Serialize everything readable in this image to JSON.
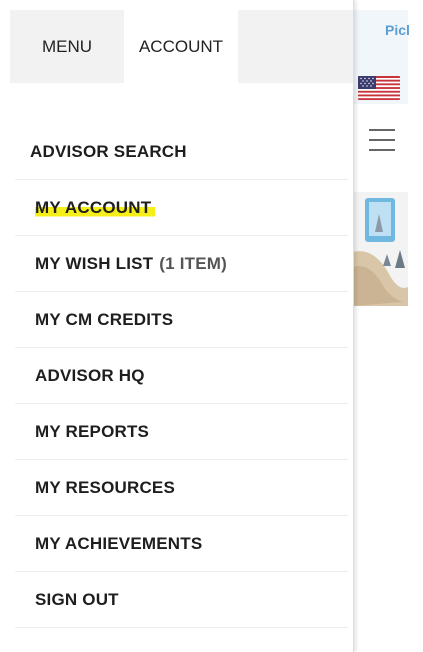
{
  "tabs": {
    "menu": "MENU",
    "account": "ACCOUNT"
  },
  "menu_items": [
    {
      "label": "ADVISOR SEARCH"
    },
    {
      "label": "MY ACCOUNT"
    },
    {
      "label": "MY WISH LIST",
      "count": "(1 ITEM)"
    },
    {
      "label": "MY CM CREDITS"
    },
    {
      "label": "ADVISOR HQ"
    },
    {
      "label": "MY REPORTS"
    },
    {
      "label": "MY RESOURCES"
    },
    {
      "label": "MY ACHIEVEMENTS"
    },
    {
      "label": "SIGN OUT"
    }
  ],
  "background_page": {
    "partial_text": "Picl"
  },
  "colors": {
    "highlight": "#f5ef17",
    "link_blue": "#5aa0d2",
    "tab_gray": "#f2f2f2"
  },
  "icons": {
    "flag": "us-flag-icon",
    "menu": "hamburger-menu-icon"
  }
}
